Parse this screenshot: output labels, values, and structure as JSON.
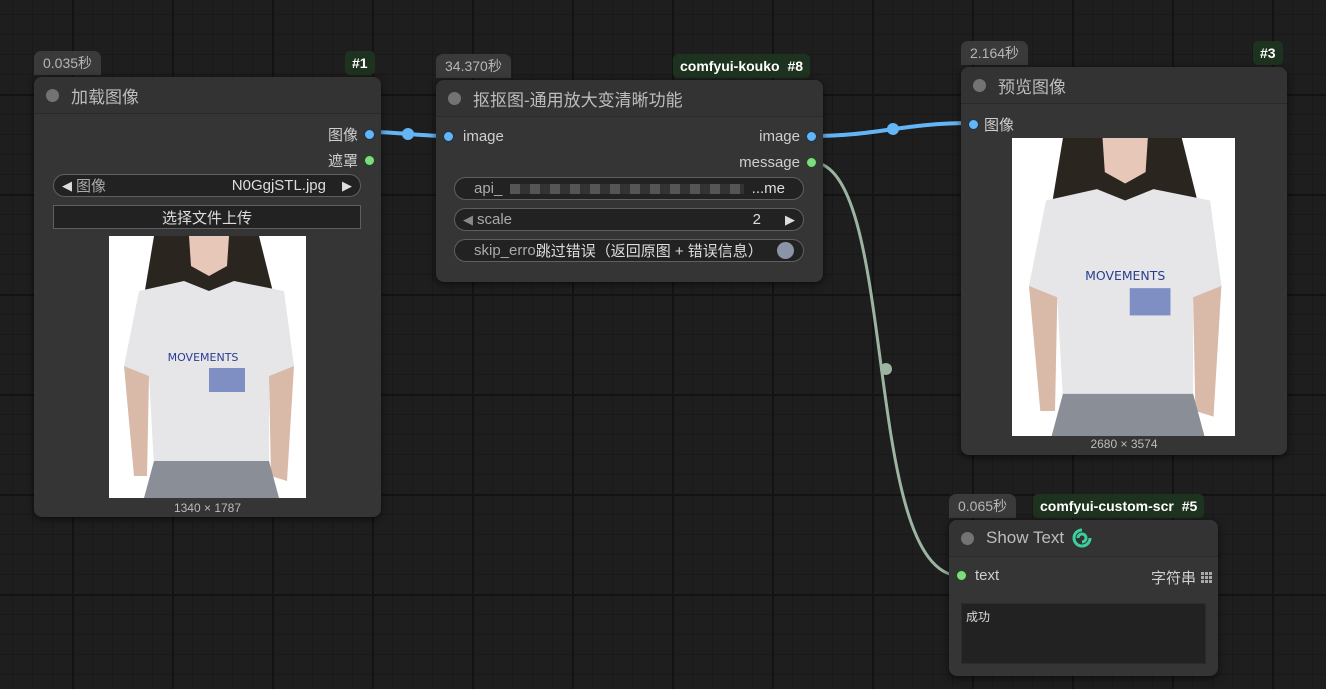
{
  "colors": {
    "image_link": "#64b5f6",
    "string_link": "#9cb5a0",
    "canvas_bg": "#1e1e1e",
    "node_bg": "#353535",
    "badge_green": "#1e331f"
  },
  "nodes": {
    "load": {
      "time": "0.035秒",
      "id": "#1",
      "title": "加载图像",
      "outputs": [
        "图像",
        "遮罩"
      ],
      "image_widget": {
        "label": "图像",
        "value": "N0GgjSTL.jpg"
      },
      "upload_label": "选择文件上传",
      "caption": "1340 × 1787",
      "shirt_text": "MOVEMENTS"
    },
    "matting": {
      "time": "34.370秒",
      "source": "comfyui-kouko",
      "id": "#8",
      "title": "抠抠图-通用放大变清晰功能",
      "input": "image",
      "outputs": [
        "image",
        "message"
      ],
      "api_widget": {
        "label": "api_",
        "value": "...me"
      },
      "scale_widget": {
        "label": "scale",
        "value": "2"
      },
      "skip_widget": {
        "label": "skip_erro",
        "value": "跳过错误（返回原图 + 错误信息）"
      }
    },
    "preview": {
      "time": "2.164秒",
      "id": "#3",
      "title": "预览图像",
      "input": "图像",
      "caption": "2680 × 3574",
      "shirt_text": "MOVEMENTS"
    },
    "show_text": {
      "time": "0.065秒",
      "source": "comfyui-custom-scr",
      "id": "#5",
      "title": "Show Text",
      "input": "text",
      "output_type": "字符串",
      "content": "成功"
    }
  },
  "icons": [
    "status-dot-icon",
    "arrow-left-icon",
    "arrow-right-icon",
    "python-logo-icon",
    "grid-icon"
  ]
}
